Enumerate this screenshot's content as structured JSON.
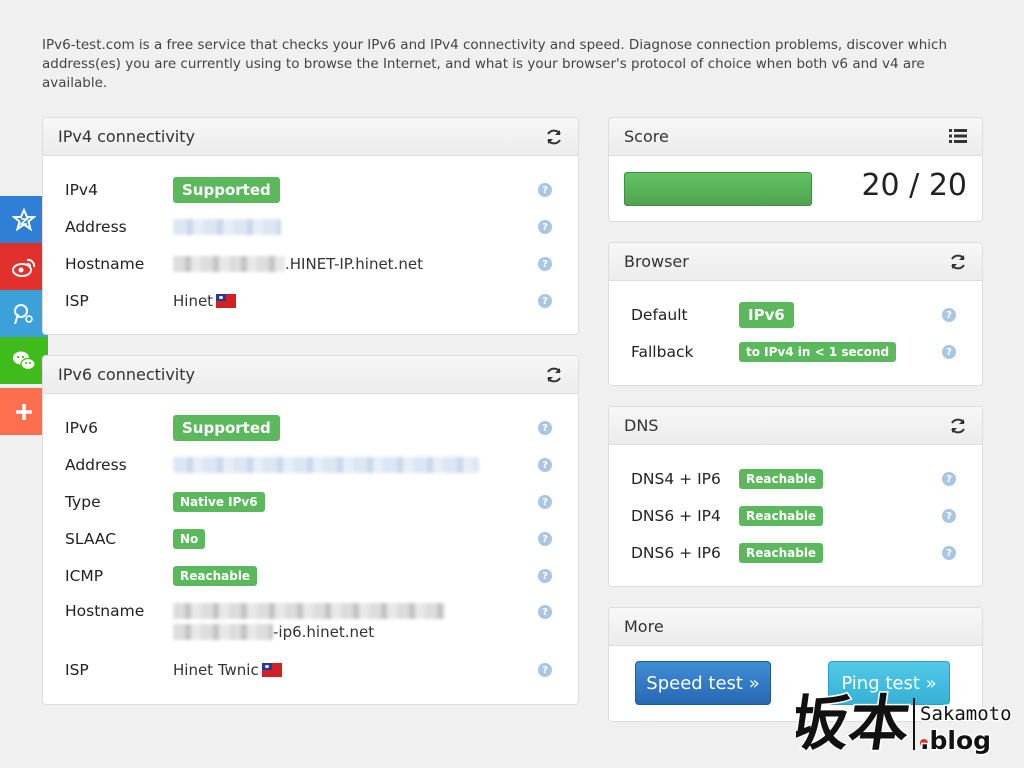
{
  "intro": "IPv6-test.com is a free service that checks your IPv6 and IPv4 connectivity and speed. Diagnose connection problems, discover which address(es) you are currently using to browse the Internet, and what is your browser's protocol of choice when both v6 and v4 are available.",
  "ipv4": {
    "title": "IPv4 connectivity",
    "rows": [
      {
        "label": "IPv4",
        "value": "Supported"
      },
      {
        "label": "Address",
        "value": ""
      },
      {
        "label": "Hostname",
        "value": ".HINET-IP.hinet.net"
      },
      {
        "label": "ISP",
        "value": "Hinet"
      }
    ]
  },
  "ipv6": {
    "title": "IPv6 connectivity",
    "rows": [
      {
        "label": "IPv6",
        "value": "Supported"
      },
      {
        "label": "Address",
        "value": ""
      },
      {
        "label": "Type",
        "value": "Native IPv6"
      },
      {
        "label": "SLAAC",
        "value": "No"
      },
      {
        "label": "ICMP",
        "value": "Reachable"
      },
      {
        "label": "Hostname",
        "value": "-ip6.hinet.net"
      },
      {
        "label": "ISP",
        "value": "Hinet Twnic"
      }
    ]
  },
  "score": {
    "title": "Score",
    "value": "20 / 20",
    "fraction": 1.0
  },
  "browser": {
    "title": "Browser",
    "rows": [
      {
        "label": "Default",
        "value": "IPv6"
      },
      {
        "label": "Fallback",
        "value": "to IPv4 in < 1 second"
      }
    ]
  },
  "dns": {
    "title": "DNS",
    "rows": [
      {
        "label": "DNS4 + IP6",
        "value": "Reachable"
      },
      {
        "label": "DNS6 + IP4",
        "value": "Reachable"
      },
      {
        "label": "DNS6 + IP6",
        "value": "Reachable"
      }
    ]
  },
  "more": {
    "title": "More",
    "speed_test": "Speed test »",
    "ping_test": "Ping test »"
  },
  "help": "?",
  "sidebar": [
    {
      "icon": "star-share-icon",
      "color": "#2f7fd6"
    },
    {
      "icon": "weibo-icon",
      "color": "#e2302c"
    },
    {
      "icon": "tencent-weibo-icon",
      "color": "#3ba1d8"
    },
    {
      "icon": "wechat-icon",
      "color": "#3fbb1c"
    },
    {
      "icon": "plus-icon",
      "color": "#ff6f4f"
    }
  ],
  "watermark": {
    "cjk": "坂本",
    "name": "Sakamoto",
    "suffix": ".blog"
  },
  "colors": {
    "badge": "#5cb85c",
    "help": "#a9c6e3",
    "score_bar": "#5cb85c",
    "speed_btn": "#2f7bc8",
    "ping_btn": "#45bfe0"
  }
}
